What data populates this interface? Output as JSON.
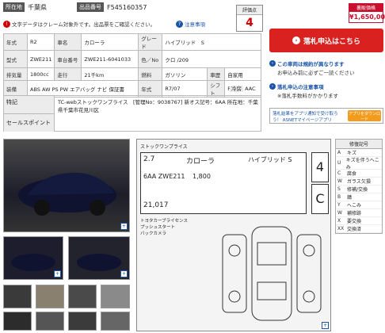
{
  "header": {
    "location_label": "所在地",
    "location_value": "千葉県",
    "lot_label": "出品番号",
    "lot_value": "F545160357"
  },
  "score": {
    "label": "評価点",
    "value": "4"
  },
  "warning_text": "文字データはクレーム対象外です。出品票をご確認ください。",
  "notes_link": "注意事項",
  "spec": {
    "rows": [
      [
        "年式",
        "R2",
        "車名",
        "カローラ",
        "グレード",
        "ハイブリッド　S"
      ],
      [
        "型式",
        "ZWE211",
        "車台番号",
        "ZWE211-6041033",
        "色／No",
        "クロ /209"
      ],
      [
        "排気量",
        "1800cc",
        "走行",
        "21千km",
        "燃料",
        "ガソリン",
        "車歴",
        "自家用"
      ],
      [
        "装備",
        "ABS AW PS PW エアバッグ ナビ 保証書",
        "年式",
        "R7/07",
        "シフト",
        "FAT",
        "冷房",
        "AAC"
      ]
    ]
  },
  "features": {
    "label_special": "特記",
    "label_selling": "セールスポイント",
    "text": "TC-webストックワンプライス　[管理No：9038767] 新オス記号：6AA 所在地：千葉県千葉市花見川区"
  },
  "price": {
    "label": "裏販価格",
    "value": "¥1,650,000"
  },
  "bid_button": "落札申込はこちら",
  "info": [
    {
      "title": "この車両は規約が異なります",
      "sub": "お申込み前に必ずご一読ください"
    },
    {
      "title": "落札申込の注意事項",
      "sub": "※落札手数料がかかります"
    }
  ],
  "app_promo": {
    "text": "落札結果をアプリ通知で受け取ろう！ ASNETマイページアプリ",
    "button": "アプリをダウンロード"
  },
  "legend": {
    "title": "修復記号",
    "items": [
      [
        "A",
        "キズ"
      ],
      [
        "U",
        "キズを伴うへこみ"
      ],
      [
        "C",
        "腐食"
      ],
      [
        "W",
        "ガラス欠損"
      ],
      [
        "S",
        "修補/交換"
      ],
      [
        "B",
        "錆"
      ],
      [
        "Y",
        "へこみ"
      ],
      [
        "W",
        "補修跡"
      ],
      [
        "X",
        "要交換"
      ],
      [
        "XX",
        "交換済"
      ]
    ]
  },
  "sheet": {
    "title": "ストックワンプライス",
    "year": "2.7",
    "car": "カローラ",
    "grade": "ハイブリッド S",
    "model": "6AA ZWE211",
    "cc": "1,800",
    "score": "4",
    "interior": "C",
    "mileage": "21,017",
    "notes": "トヨタカーブライセンス\nプッシュスタート\nバックカメラ"
  },
  "colors": {
    "accent": "#d9211f",
    "link": "#1a55a8"
  }
}
